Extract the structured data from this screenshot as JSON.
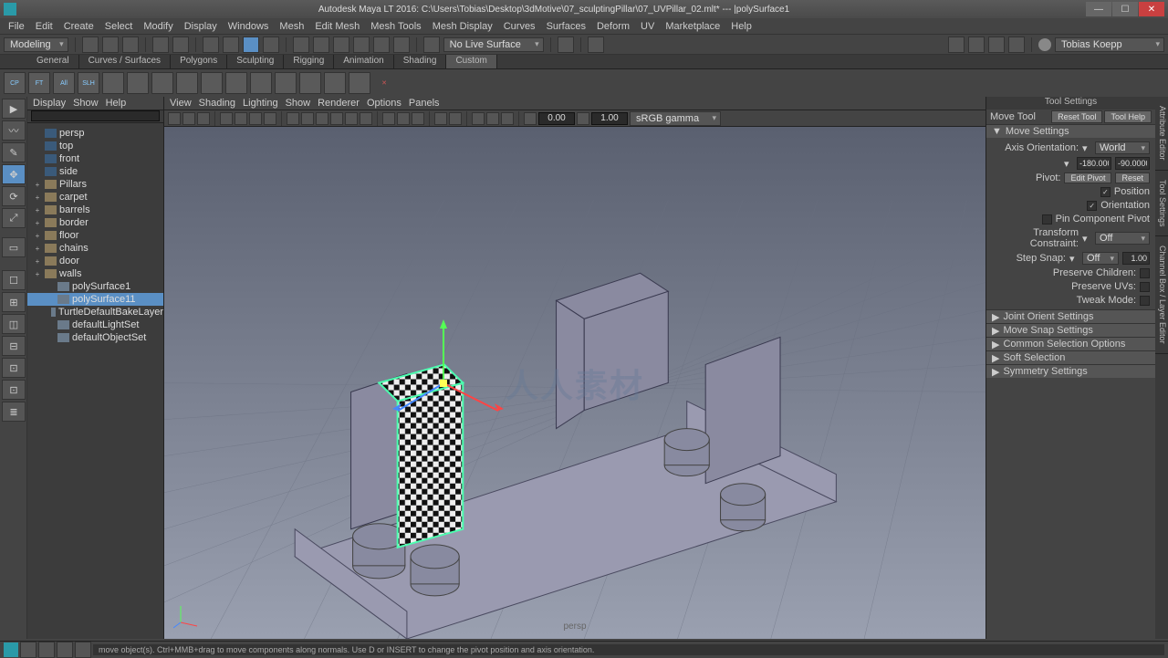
{
  "window": {
    "title": "Autodesk Maya LT 2016: C:\\Users\\Tobias\\Desktop\\3dMotive\\07_sculptingPillar\\07_UVPillar_02.mlt*   ---   |polySurface1",
    "min": "—",
    "max": "☐",
    "close": "✕"
  },
  "menu": [
    "File",
    "Edit",
    "Create",
    "Select",
    "Modify",
    "Display",
    "Windows",
    "Mesh",
    "Edit Mesh",
    "Mesh Tools",
    "Mesh Display",
    "Curves",
    "Surfaces",
    "Deform",
    "UV",
    "Marketplace",
    "Help"
  ],
  "workspace": "Modeling",
  "no_live": "No Live Surface",
  "user": "Tobias Koepp",
  "shelf_tabs": [
    "General",
    "Curves / Surfaces",
    "Polygons",
    "Sculpting",
    "Rigging",
    "Animation",
    "Shading",
    "Custom"
  ],
  "shelf_active": 7,
  "shelf_icons": [
    "CP",
    "FT",
    "All",
    "SLH",
    "",
    "",
    "",
    "",
    "",
    "",
    "",
    "",
    "",
    "",
    ""
  ],
  "outliner": {
    "head": [
      "Display",
      "Show",
      "Help"
    ],
    "items": [
      {
        "indent": 0,
        "icon": "cam",
        "label": "persp"
      },
      {
        "indent": 0,
        "icon": "cam",
        "label": "top"
      },
      {
        "indent": 0,
        "icon": "cam",
        "label": "front"
      },
      {
        "indent": 0,
        "icon": "cam",
        "label": "side"
      },
      {
        "indent": 0,
        "icon": "grp",
        "label": "Pillars",
        "expand": "+"
      },
      {
        "indent": 0,
        "icon": "grp",
        "label": "carpet",
        "expand": "+"
      },
      {
        "indent": 0,
        "icon": "grp",
        "label": "barrels",
        "expand": "+"
      },
      {
        "indent": 0,
        "icon": "grp",
        "label": "border",
        "expand": "+"
      },
      {
        "indent": 0,
        "icon": "grp",
        "label": "floor",
        "expand": "+"
      },
      {
        "indent": 0,
        "icon": "grp",
        "label": "chains",
        "expand": "+"
      },
      {
        "indent": 0,
        "icon": "grp",
        "label": "door",
        "expand": "+"
      },
      {
        "indent": 0,
        "icon": "grp",
        "label": "walls",
        "expand": "+"
      },
      {
        "indent": 1,
        "icon": "mesh",
        "label": "polySurface1"
      },
      {
        "indent": 1,
        "icon": "mesh",
        "label": "polySurface11",
        "selected": true
      },
      {
        "indent": 1,
        "icon": "set",
        "label": "TurtleDefaultBakeLayer"
      },
      {
        "indent": 1,
        "icon": "set",
        "label": "defaultLightSet"
      },
      {
        "indent": 1,
        "icon": "set",
        "label": "defaultObjectSet"
      }
    ]
  },
  "viewport": {
    "head": [
      "View",
      "Shading",
      "Lighting",
      "Show",
      "Renderer",
      "Options",
      "Panels"
    ],
    "fields": {
      "a": "0.00",
      "b": "1.00",
      "gamma": "sRGB gamma"
    },
    "camera": "persp",
    "watermark": "人人素材"
  },
  "tool_settings": {
    "title": "Tool Settings",
    "tool_name": "Move Tool",
    "reset": "Reset Tool",
    "help": "Tool Help",
    "section1": "Move Settings",
    "axis_orientation_label": "Axis Orientation:",
    "axis_orientation": "World",
    "rot1": "-180.0000",
    "rot2": "-90.0000",
    "pivot_label": "Pivot:",
    "edit_pivot": "Edit Pivot",
    "reset_pivot": "Reset",
    "chk_position": "Position",
    "chk_orientation": "Orientation",
    "chk_pin": "Pin Component Pivot",
    "transform_constraint_label": "Transform Constraint:",
    "transform_constraint": "Off",
    "step_snap_label": "Step Snap:",
    "step_snap": "Off",
    "step_val": "1.00",
    "preserve_children": "Preserve Children:",
    "preserve_uvs": "Preserve UVs:",
    "tweak_mode": "Tweak Mode:",
    "collapsed": [
      "Joint Orient Settings",
      "Move Snap Settings",
      "Common Selection Options",
      "Soft Selection",
      "Symmetry Settings"
    ]
  },
  "side_tabs": [
    "Attribute Editor",
    "Tool Settings",
    "Channel Box / Layer Editor"
  ],
  "hint": "move object(s). Ctrl+MMB+drag to move components along normals. Use D or INSERT to change the pivot position and axis orientation."
}
